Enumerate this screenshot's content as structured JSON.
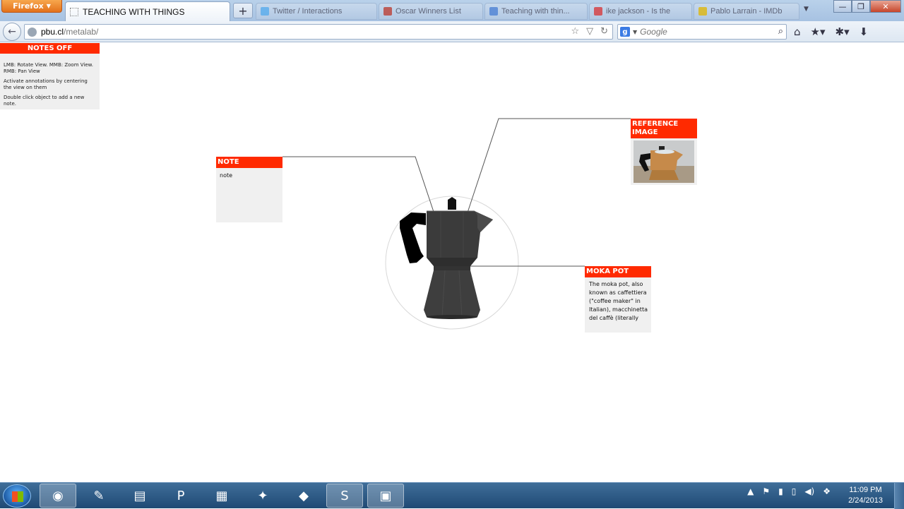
{
  "browser": {
    "menu_button": "Firefox",
    "active_tab": "TEACHING WITH THINGS",
    "background_tabs": [
      {
        "label": "Twitter / Interactions",
        "color": "#55acee"
      },
      {
        "label": "Oscar Winners List",
        "color": "#c0392b"
      },
      {
        "label": "Teaching with thin...",
        "color": "#4a7fd4"
      },
      {
        "label": "ike jackson - Is the",
        "color": "#d33"
      },
      {
        "label": "Pablo Larrain - IMDb",
        "color": "#e6b800"
      }
    ],
    "new_tab": "+",
    "url_host": "pbu.cl",
    "url_path": "/metalab/",
    "search_placeholder": "Google"
  },
  "panel": {
    "toggle_label": "NOTES OFF",
    "help_lines": [
      "LMB: Rotate View. MMB: Zoom View. RMB: Pan View",
      "Activate annotations by centering the view on them",
      "Double click object to add a new note."
    ]
  },
  "annotations": {
    "note": {
      "title": "NOTE",
      "body": "note"
    },
    "reference": {
      "title": "REFERENCE IMAGE"
    },
    "moka": {
      "title": "MOKA POT",
      "body": "The moka pot, also known as caffettiera (\"coffee maker\" in Italian), macchinetta del caffè (literally"
    }
  },
  "taskbar": {
    "time": "11:09 PM",
    "date": "2/24/2013",
    "items": [
      {
        "name": "firefox",
        "glyph": "◉",
        "active": true
      },
      {
        "name": "notepad",
        "glyph": "✎",
        "active": false
      },
      {
        "name": "folder",
        "glyph": "▤",
        "active": false
      },
      {
        "name": "app-p",
        "glyph": "P",
        "active": false
      },
      {
        "name": "calculator",
        "glyph": "▦",
        "active": false
      },
      {
        "name": "gimp",
        "glyph": "✦",
        "active": false
      },
      {
        "name": "inkscape",
        "glyph": "◆",
        "active": false
      },
      {
        "name": "skype",
        "glyph": "S",
        "active": true
      },
      {
        "name": "photo-viewer",
        "glyph": "▣",
        "active": true
      }
    ]
  },
  "colors": {
    "accent": "#ff2a00",
    "note_bg": "#f0f0f0",
    "pot_body": "#3b3b3b",
    "handle": "#000000"
  }
}
